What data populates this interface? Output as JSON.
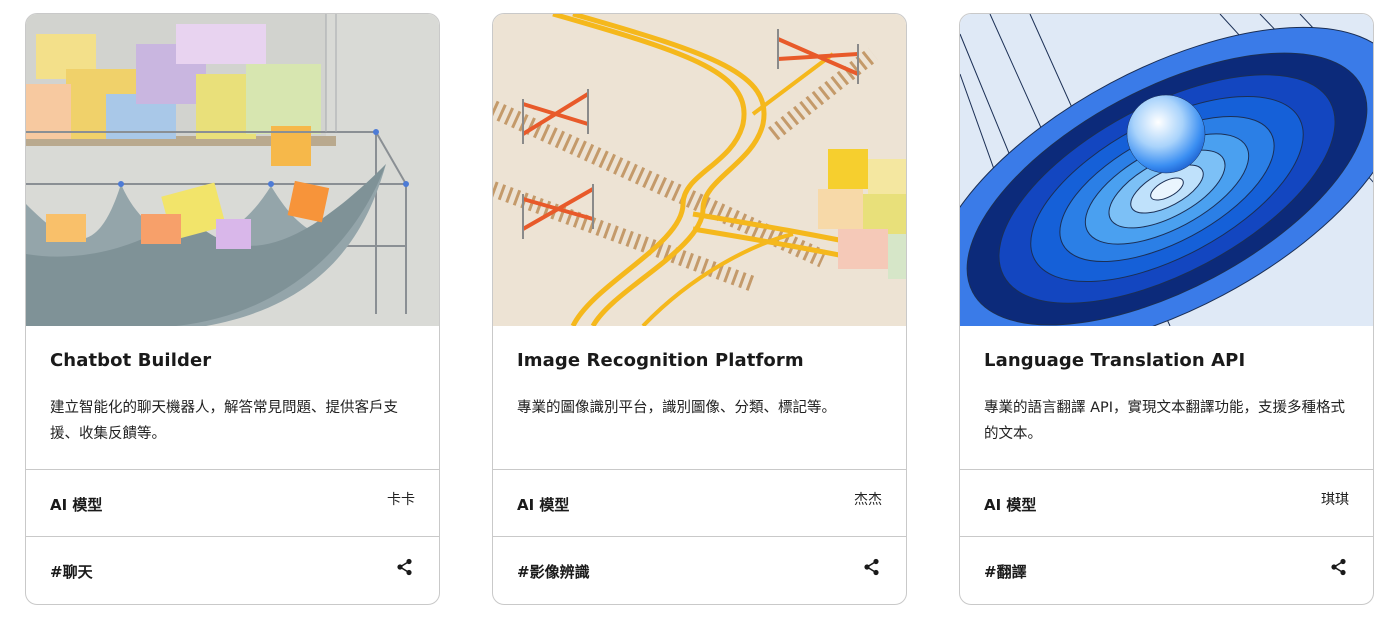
{
  "cards": [
    {
      "title": "Chatbot Builder",
      "description": "建立智能化的聊天機器人，解答常見問題、提供客戶支援、收集反饋等。",
      "category": "AI 模型",
      "author": "卡卡",
      "tag": "#聊天",
      "share_icon": "share-icon"
    },
    {
      "title": "Image Recognition Platform",
      "description": "專業的圖像識別平台，識別圖像、分類、標記等。",
      "category": "AI 模型",
      "author": "杰杰",
      "tag": "#影像辨識",
      "share_icon": "share-icon"
    },
    {
      "title": "Language Translation API",
      "description": "專業的語言翻譯 API，實現文本翻譯功能，支援多種格式的文本。",
      "category": "AI 模型",
      "author": "琪琪",
      "tag": "#翻譯",
      "share_icon": "share-icon"
    }
  ],
  "colors": {
    "border": "#c9c9c9",
    "text": "#1a1a1a",
    "track_yellow": "#f5b81c",
    "barrier_orange": "#e85a2a",
    "swirl_blue": "#1560d8"
  }
}
